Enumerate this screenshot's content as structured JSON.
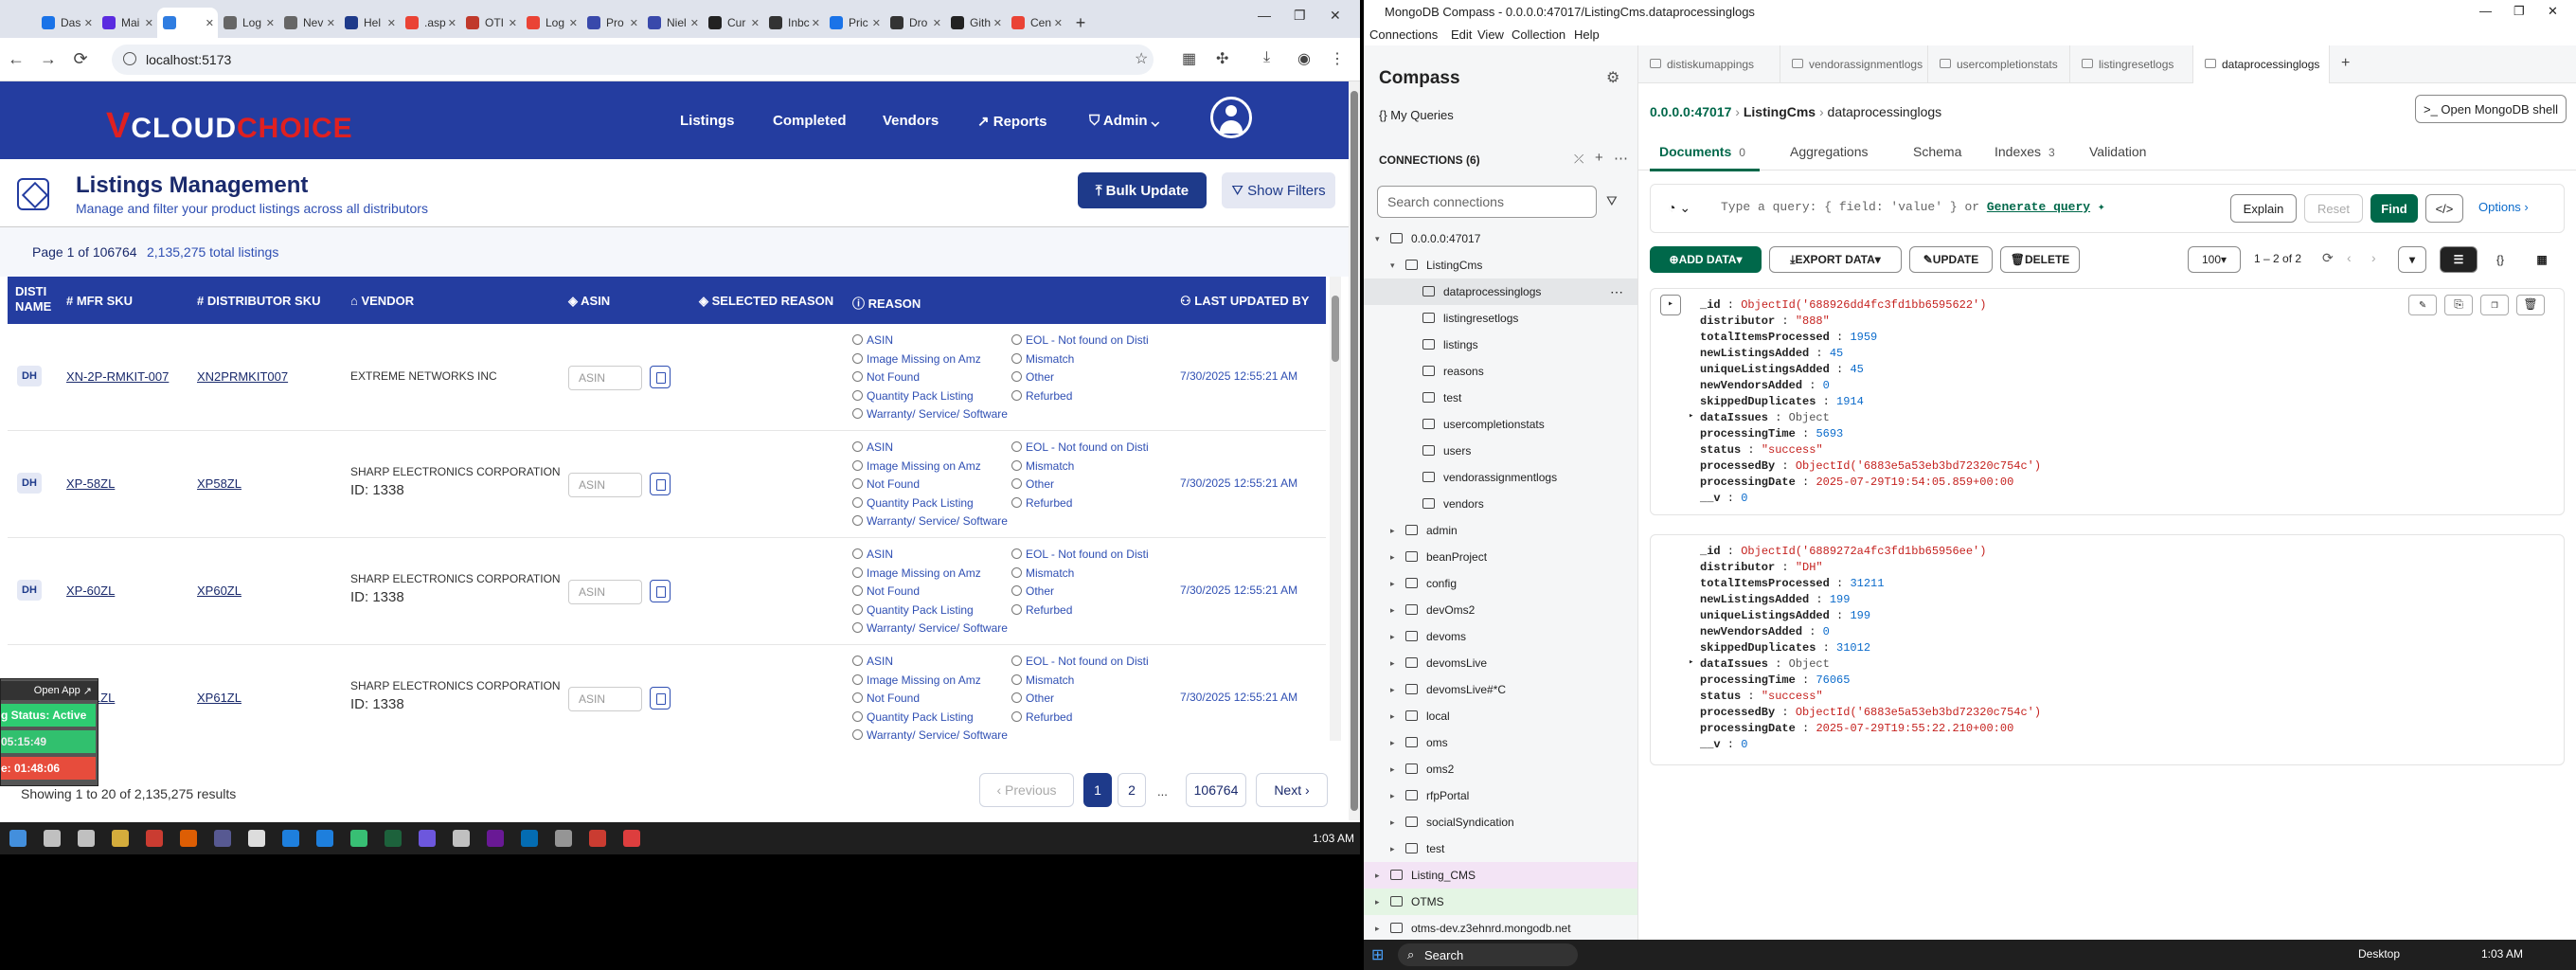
{
  "browser": {
    "tabs": [
      {
        "label": "Das",
        "color": "#1a73e8"
      },
      {
        "label": "Mai",
        "color": "#5b2be0"
      },
      {
        "label": "",
        "color": "#2f7de1",
        "active": true
      },
      {
        "label": "Log",
        "color": "#666666"
      },
      {
        "label": "Nev",
        "color": "#666666"
      },
      {
        "label": "Hel",
        "color": "#1e3a8a"
      },
      {
        "label": ".asp",
        "color": "#ea4335"
      },
      {
        "label": "OTI",
        "color": "#c0392b"
      },
      {
        "label": "Log",
        "color": "#ea4335"
      },
      {
        "label": "Pro",
        "color": "#3949ab"
      },
      {
        "label": "Niel",
        "color": "#3949ab"
      },
      {
        "label": "Cur",
        "color": "#222222"
      },
      {
        "label": "Inbc",
        "color": "#333333"
      },
      {
        "label": "Pric",
        "color": "#1a73e8"
      },
      {
        "label": "Dro",
        "color": "#333333"
      },
      {
        "label": "Gith",
        "color": "#222222"
      },
      {
        "label": "Cen",
        "color": "#ea4335"
      }
    ],
    "url": "localhost:5173"
  },
  "app": {
    "logo_v": "V",
    "logo_cloud": "CLOUD",
    "logo_choice": "CHOICE",
    "nav": {
      "listings": "Listings",
      "completed": "Completed",
      "vendors": "Vendors",
      "reports": "Reports",
      "admin": "Admin"
    },
    "title": "Listings Management",
    "subtitle": "Manage and filter your product listings across all distributors",
    "bulk_update": "Bulk Update",
    "show_filters": "Show Filters",
    "page_info": "Page 1 of 106764",
    "total_listings": "2,135,275 total listings",
    "columns": {
      "distributor": "DISTI NAME",
      "mfr_sku": "MFR SKU",
      "distributor_sku": "DISTRIBUTOR SKU",
      "vendor": "VENDOR",
      "asin": "ASIN",
      "selected_reason": "SELECTED REASON",
      "reason": "REASON",
      "last_updated_by": "LAST UPDATED BY"
    },
    "reason_options_left": [
      "ASIN",
      "Image Missing on Amz",
      "Not Found",
      "Quantity Pack Listing",
      "Warranty/ Service/ Software"
    ],
    "reason_options_right": [
      "EOL - Not found on Disti",
      "Mismatch",
      "Other",
      "Refurbed"
    ],
    "asin_placeholder": "ASIN",
    "rows": [
      {
        "disti": "DH",
        "mfr_sku": "XN-2P-RMKIT-007",
        "distributor_sku": "XN2PRMKIT007",
        "vendor": "EXTREME NETWORKS INC",
        "vendor_id": "",
        "updated": "7/30/2025 12:55:21 AM"
      },
      {
        "disti": "DH",
        "mfr_sku": "XP-58ZL",
        "distributor_sku": "XP58ZL",
        "vendor": "SHARP ELECTRONICS CORPORATION",
        "vendor_id": "ID: 1338",
        "updated": "7/30/2025 12:55:21 AM"
      },
      {
        "disti": "DH",
        "mfr_sku": "XP-60ZL",
        "distributor_sku": "XP60ZL",
        "vendor": "SHARP ELECTRONICS CORPORATION",
        "vendor_id": "ID: 1338",
        "updated": "7/30/2025 12:55:21 AM"
      },
      {
        "disti": "DH",
        "mfr_sku": "XP-61ZL",
        "distributor_sku": "XP61ZL",
        "vendor": "SHARP ELECTRONICS CORPORATION",
        "vendor_id": "ID: 1338",
        "updated": "7/30/2025 12:55:21 AM"
      }
    ],
    "showing": "Showing 1 to 20 of 2,135,275 results",
    "pagination": {
      "previous": "Previous",
      "p1": "1",
      "p2": "2",
      "ellipsis": "...",
      "last": "106764",
      "next": "Next"
    },
    "widget": {
      "open_app": "Open App",
      "status": "g Status: Active",
      "time1": "05:15:49",
      "time2": "e: 01:48:06"
    }
  },
  "taskbar_left": {
    "clock": "1:03 AM"
  },
  "compass": {
    "window_title": "MongoDB Compass - 0.0.0.0:47017/ListingCms.dataprocessinglogs",
    "menu": [
      "Connections",
      "Edit",
      "View",
      "Collection",
      "Help"
    ],
    "heading": "Compass",
    "my_queries": "My Queries",
    "connections_label": "CONNECTIONS",
    "connections_count": "(6)",
    "search_placeholder": "Search connections",
    "tree": {
      "connection": "0.0.0.0:47017",
      "db": "ListingCms",
      "collections": [
        "dataprocessinglogs",
        "listingresetlogs",
        "listings",
        "reasons",
        "test",
        "usercompletionstats",
        "users",
        "vendorassignmentlogs",
        "vendors"
      ],
      "databases": [
        "admin",
        "beanProject",
        "config",
        "devOms2",
        "devoms",
        "devomsLive",
        "devomsLive#*C",
        "local",
        "oms",
        "oms2",
        "rfpPortal",
        "socialSyndication",
        "test"
      ],
      "other_connections": [
        "Listing_CMS",
        "OTMS",
        "otms-dev.z3ehnrd.mongodb.net"
      ]
    },
    "tabs": [
      "distiskumappings",
      "vendorassignmentlogs",
      "usercompletionstats",
      "listingresetlogs",
      "dataprocessinglogs"
    ],
    "breadcrumb": {
      "host": "0.0.0.0:47017",
      "db": "ListingCms",
      "coll": "dataprocessinglogs"
    },
    "open_shell": "Open MongoDB shell",
    "subtabs": {
      "documents": "Documents",
      "documents_count": "0",
      "aggregations": "Aggregations",
      "schema": "Schema",
      "indexes": "Indexes",
      "indexes_count": "3",
      "validation": "Validation"
    },
    "query_placeholder": "Type a query: { field: 'value' } or",
    "generate_query": "Generate query",
    "explain": "Explain",
    "reset": "Reset",
    "find": "Find",
    "options": "Options",
    "add_data": "ADD DATA",
    "export_data": "EXPORT DATA",
    "update": "UPDATE",
    "delete": "DELETE",
    "page_size": "100",
    "range": "1 – 2 of 2",
    "documents": [
      {
        "fields": [
          [
            "_id",
            "ObjectId('688926dd4fc3fd1bb6595622')",
            "v"
          ],
          [
            "distributor",
            "\"888\"",
            "v"
          ],
          [
            "totalItemsProcessed",
            "1959",
            "n"
          ],
          [
            "newListingsAdded",
            "45",
            "n"
          ],
          [
            "uniqueListingsAdded",
            "45",
            "n"
          ],
          [
            "newVendorsAdded",
            "0",
            "n"
          ],
          [
            "skippedDuplicates",
            "1914",
            "n"
          ],
          [
            "dataIssues",
            "Object",
            "o"
          ],
          [
            "processingTime",
            "5693",
            "n"
          ],
          [
            "status",
            "\"success\"",
            "v"
          ],
          [
            "processedBy",
            "ObjectId('6883e5a53eb3bd72320c754c')",
            "v"
          ],
          [
            "processingDate",
            "2025-07-29T19:54:05.859+00:00",
            "v"
          ],
          [
            "__v",
            "0",
            "n"
          ]
        ]
      },
      {
        "fields": [
          [
            "_id",
            "ObjectId('6889272a4fc3fd1bb65956ee')",
            "v"
          ],
          [
            "distributor",
            "\"DH\"",
            "v"
          ],
          [
            "totalItemsProcessed",
            "31211",
            "n"
          ],
          [
            "newListingsAdded",
            "199",
            "n"
          ],
          [
            "uniqueListingsAdded",
            "199",
            "n"
          ],
          [
            "newVendorsAdded",
            "0",
            "n"
          ],
          [
            "skippedDuplicates",
            "31012",
            "n"
          ],
          [
            "dataIssues",
            "Object",
            "o"
          ],
          [
            "processingTime",
            "76065",
            "n"
          ],
          [
            "status",
            "\"success\"",
            "v"
          ],
          [
            "processedBy",
            "ObjectId('6883e5a53eb3bd72320c754c')",
            "v"
          ],
          [
            "processingDate",
            "2025-07-29T19:55:22.210+00:00",
            "v"
          ],
          [
            "__v",
            "0",
            "n"
          ]
        ]
      }
    ],
    "taskbar": {
      "search": "Search",
      "desktop": "Desktop",
      "clock": "1:03 AM"
    }
  }
}
